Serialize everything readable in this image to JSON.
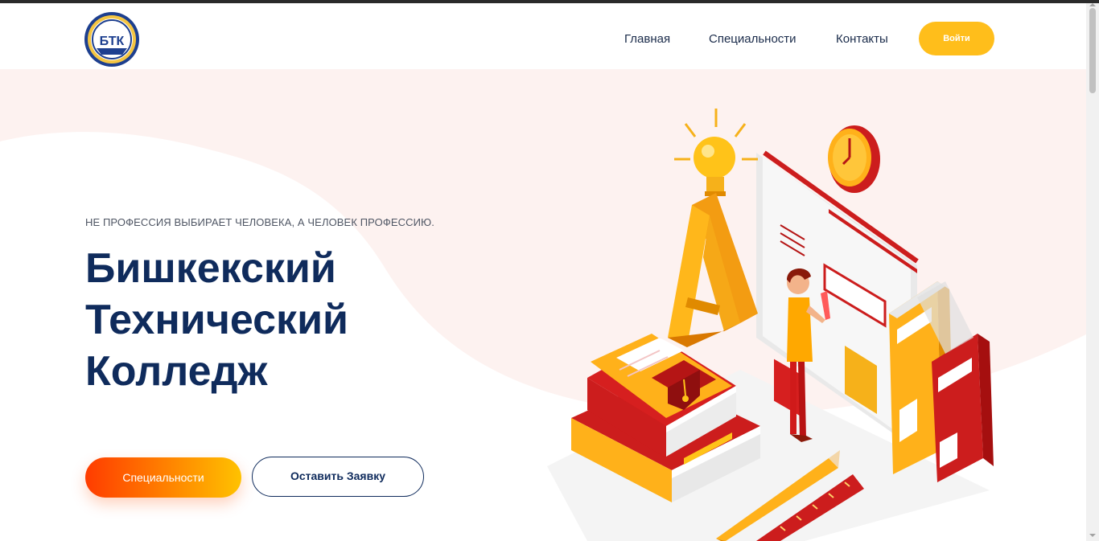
{
  "header": {
    "logo_text": "БТК",
    "nav": {
      "home": "Главная",
      "specialties": "Специальности",
      "contacts": "Контакты"
    },
    "login_label": "Войти"
  },
  "hero": {
    "tagline": "НЕ ПРОФЕССИЯ ВЫБИРАЕТ ЧЕЛОВЕКА, А ЧЕЛОВЕК ПРОФЕССИЮ.",
    "title_line1": "Бишкекский",
    "title_line2": "Технический",
    "title_line3": "Колледж",
    "primary_button": "Специальности",
    "secondary_button": "Оставить Заявку"
  },
  "colors": {
    "accent": "#ffbe1b",
    "title": "#0f2b5c",
    "hero_bg": "#fdf3f1",
    "gradient_start": "#ff3c00",
    "gradient_end": "#ffc200"
  },
  "illustration": {
    "icons": [
      "lightbulb-icon",
      "clock-icon",
      "letter-a-icon",
      "books-icon",
      "graduation-cap-icon",
      "pencil-icon",
      "ruler-icon",
      "person-figure",
      "binders-icon"
    ]
  }
}
